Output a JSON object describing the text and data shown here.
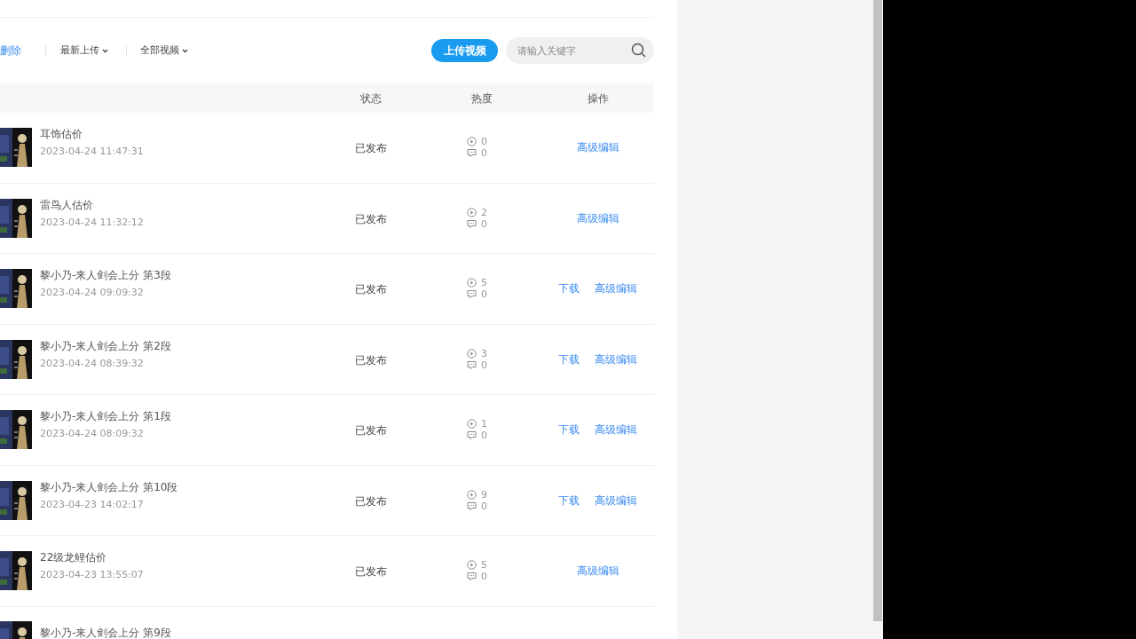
{
  "toolbar": {
    "delete_link": "删除",
    "sort_dropdown": "最新上传",
    "filter_dropdown": "全部视频",
    "upload_button": "上传视频",
    "search": {
      "placeholder": "请输入关键字"
    }
  },
  "table": {
    "columns": [
      "状态",
      "热度",
      "操作"
    ],
    "rows": [
      {
        "title": "耳饰估价",
        "date": "2023-04-24 11:47:31",
        "status": "已发布",
        "plays": "0",
        "comments": "0",
        "actions": [
          "高级编辑"
        ]
      },
      {
        "title": "雷鸟人估价",
        "date": "2023-04-24 11:32:12",
        "status": "已发布",
        "plays": "2",
        "comments": "0",
        "actions": [
          "高级编辑"
        ]
      },
      {
        "title": "黎小乃-来人剑会上分 第3段",
        "date": "2023-04-24 09:09:32",
        "status": "已发布",
        "plays": "5",
        "comments": "0",
        "actions": [
          "下载",
          "高级编辑"
        ]
      },
      {
        "title": "黎小乃-来人剑会上分 第2段",
        "date": "2023-04-24 08:39:32",
        "status": "已发布",
        "plays": "3",
        "comments": "0",
        "actions": [
          "下载",
          "高级编辑"
        ]
      },
      {
        "title": "黎小乃-来人剑会上分 第1段",
        "date": "2023-04-24 08:09:32",
        "status": "已发布",
        "plays": "1",
        "comments": "0",
        "actions": [
          "下载",
          "高级编辑"
        ]
      },
      {
        "title": "黎小乃-来人剑会上分 第10段",
        "date": "2023-04-23 14:02:17",
        "status": "已发布",
        "plays": "9",
        "comments": "0",
        "actions": [
          "下载",
          "高级编辑"
        ]
      },
      {
        "title": "22级龙鲤估价",
        "date": "2023-04-23 13:55:07",
        "status": "已发布",
        "plays": "5",
        "comments": "0",
        "actions": [
          "高级编辑"
        ]
      },
      {
        "title": "黎小乃-来人剑会上分 第9段",
        "actions": []
      }
    ]
  }
}
